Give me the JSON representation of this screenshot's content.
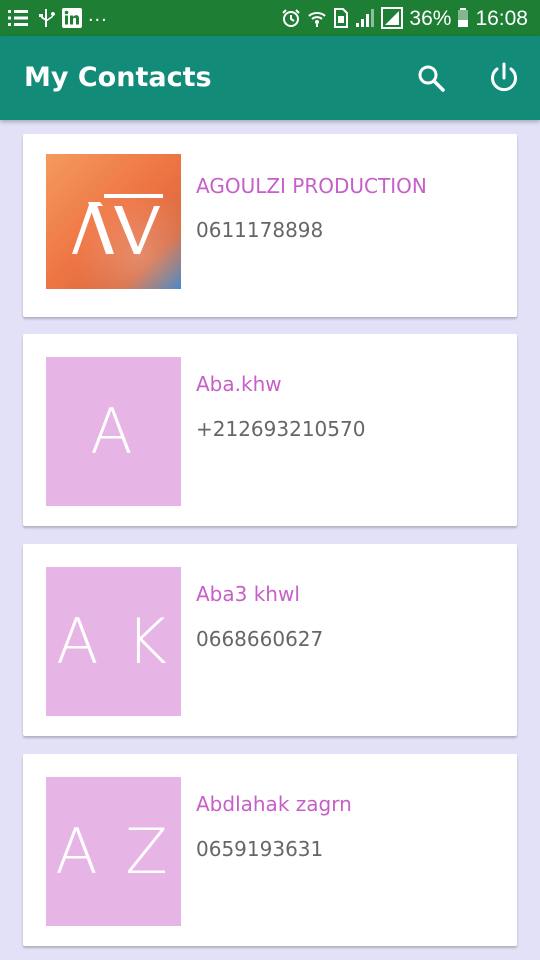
{
  "status_bar": {
    "battery": "36%",
    "time": "16:08",
    "overflow": "...",
    "icons": [
      "list-icon",
      "usb-icon",
      "linkedin-icon",
      "alarm-icon",
      "wifi-icon",
      "sim-icon",
      "signal-icon",
      "signal-r-icon",
      "battery-icon"
    ]
  },
  "app_bar": {
    "title": "My Contacts",
    "actions": [
      "search-icon",
      "power-icon"
    ]
  },
  "contacts": [
    {
      "name": "AGOULZI PRODUCTION",
      "phone": "0611178898",
      "avatar_type": "logo",
      "avatar_icon": "av-logo-icon"
    },
    {
      "name": "Aba.khw",
      "phone": "+212693210570",
      "initials": "A"
    },
    {
      "name": "Aba3 khwl",
      "phone": "0668660627",
      "initials": "A K"
    },
    {
      "name": "Abdlahak zagrn",
      "phone": "0659193631",
      "initials": "A Z"
    }
  ],
  "colors": {
    "status_bar": "#1e7e34",
    "app_bar": "#128b79",
    "background": "#e2e1f7",
    "name_text": "#c75fc9",
    "phone_text": "#666666",
    "initials_avatar": "#e6b5e5"
  }
}
